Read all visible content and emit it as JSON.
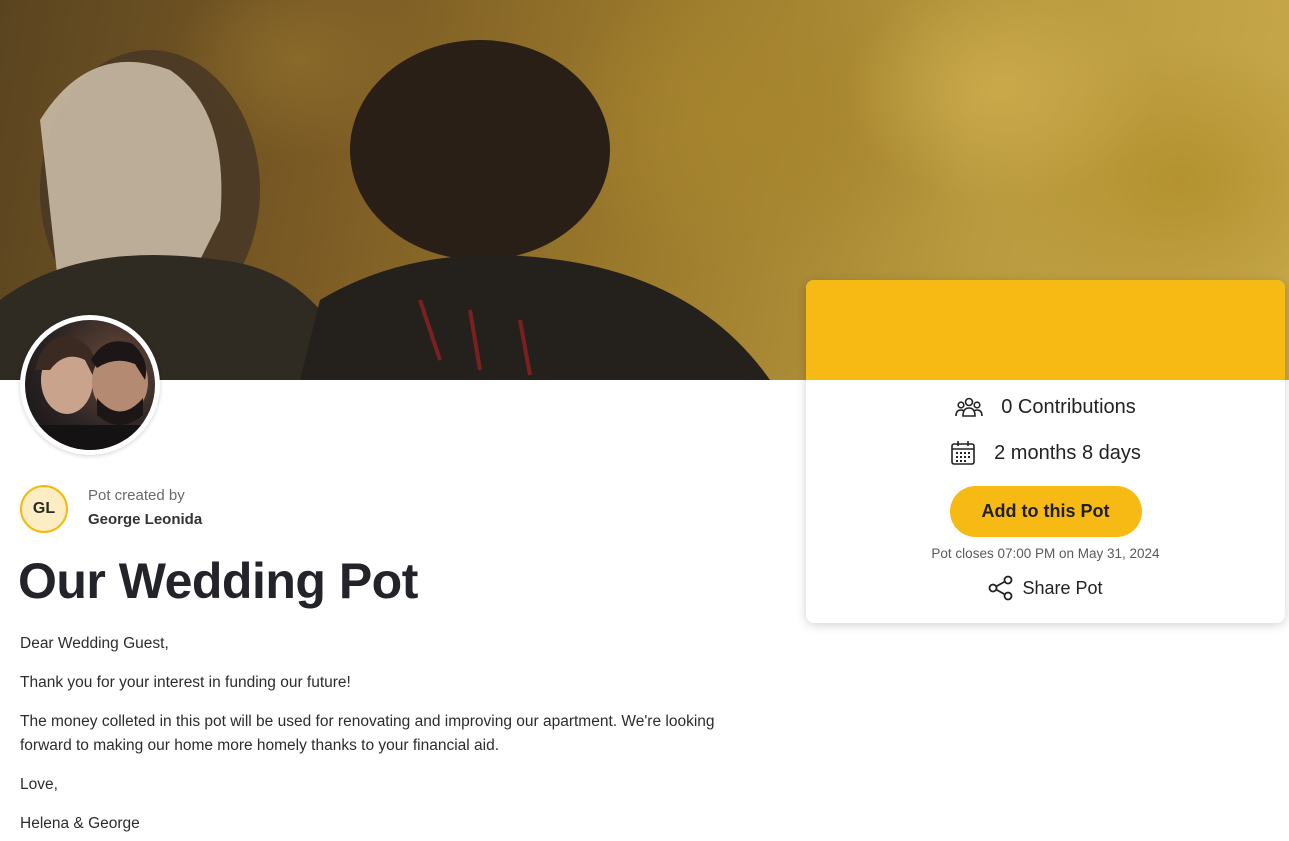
{
  "hero": {
    "description_icon": "couple-photo"
  },
  "creator": {
    "initials": "GL",
    "label": "Pot created by",
    "name": "George Leonida"
  },
  "pot": {
    "title": "Our Wedding Pot",
    "message": [
      "Dear Wedding Guest,",
      "Thank you for your interest in funding our future!",
      "The money colleted in this pot will be used for renovating and improving our apartment. We're looking forward to making our home more homely thanks to your financial aid.",
      "Love,",
      "Helena & George"
    ]
  },
  "card": {
    "contributions": "0 Contributions",
    "time_left": "2 months 8 days",
    "add_button": "Add to this Pot",
    "closes": "Pot closes 07:00 PM on May 31, 2024",
    "share": "Share Pot"
  },
  "colors": {
    "accent": "#f7b914",
    "initials_bg": "#fdedc2",
    "text": "#23232a"
  }
}
